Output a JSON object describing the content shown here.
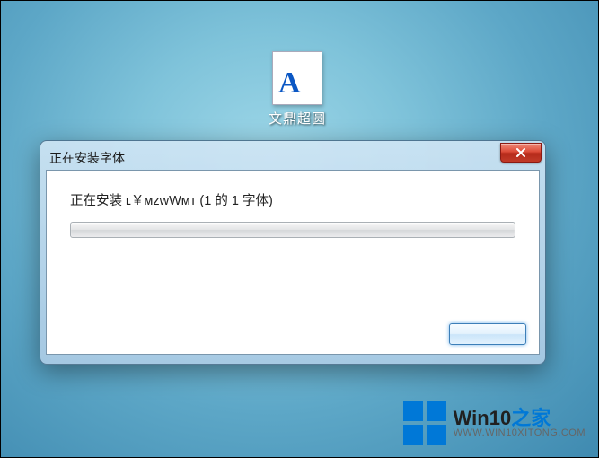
{
  "desktop": {
    "icon_glyph": "A",
    "icon_label": "文鼎超圆"
  },
  "dialog": {
    "title": "正在安装字体",
    "installing_label": "正在安装 ʟ￥ᴍᴢᴡWᴍᴛ (1 的 1 字体)",
    "progress_percent": 0,
    "button_label": ""
  },
  "watermark": {
    "line1_a": "Win10",
    "line1_b": "之家",
    "line2": "WWW.WIN10XITONG.COM"
  }
}
